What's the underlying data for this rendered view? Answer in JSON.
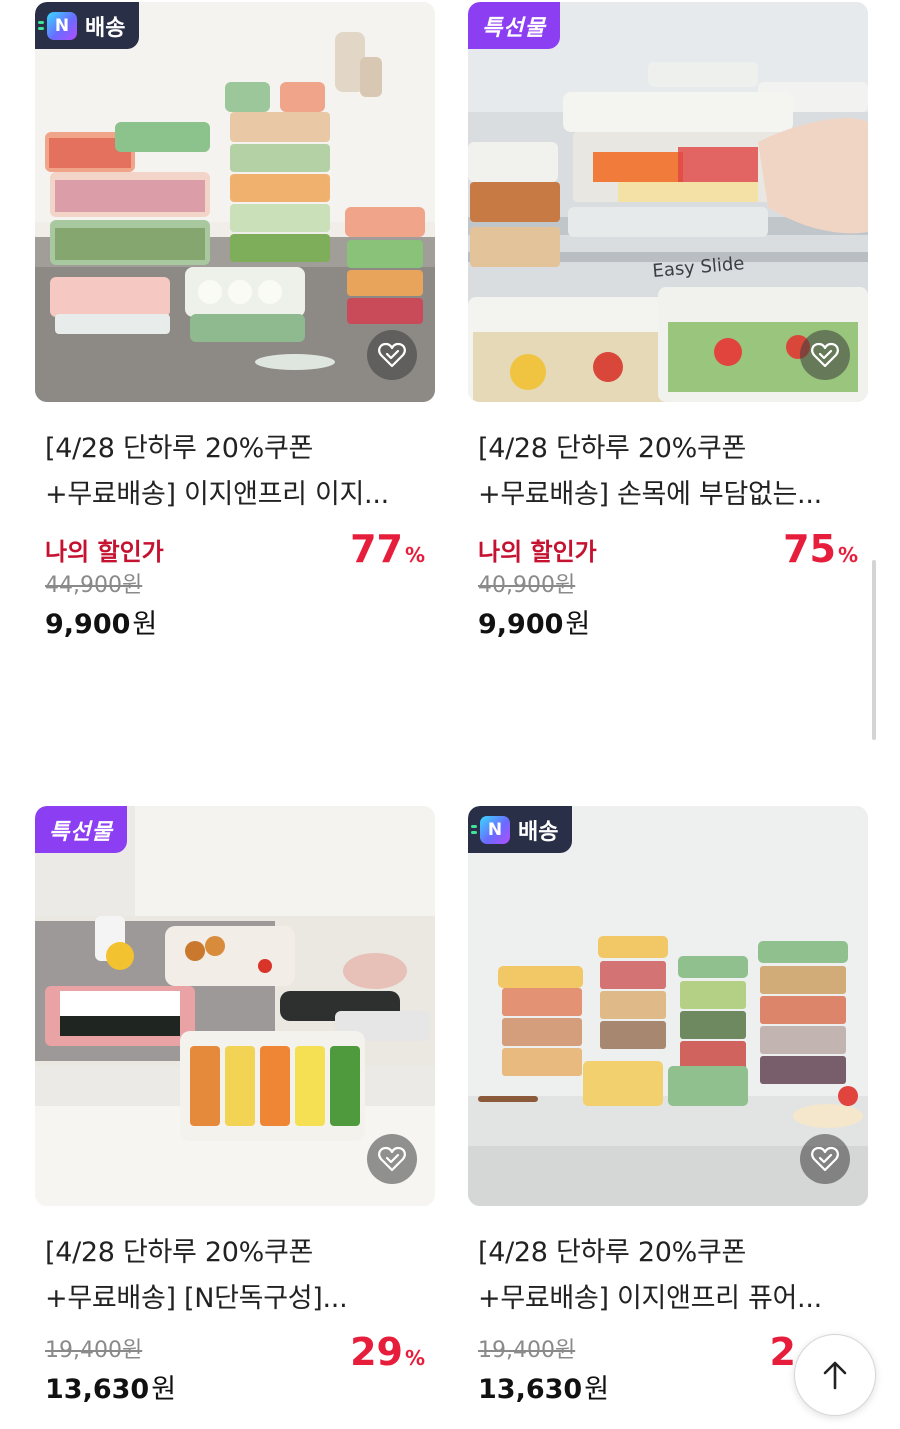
{
  "products": [
    {
      "badge_type": "ndelivery",
      "badge_text": "배송",
      "badge_logo": "N",
      "title_line1": "[4/28 단하루 20%쿠폰",
      "title_line2": "+무료배송] 이지앤프리 이지...",
      "my_price_label": "나의 할인가",
      "original_price": "44,900원",
      "sale_price": "9,900",
      "currency": "원",
      "discount": "77",
      "pct": "%"
    },
    {
      "badge_type": "gift",
      "badge_text": "특선물",
      "title_line1": "[4/28 단하루 20%쿠폰",
      "title_line2": "+무료배송] 손목에 부담없는...",
      "my_price_label": "나의 할인가",
      "original_price": "40,900원",
      "sale_price": "9,900",
      "currency": "원",
      "discount": "75",
      "pct": "%",
      "image_text": "Easy Slide"
    },
    {
      "badge_type": "gift",
      "badge_text": "특선물",
      "title_line1": "[4/28 단하루 20%쿠폰",
      "title_line2": "+무료배송] [N단독구성]...",
      "original_price": "19,400원",
      "sale_price": "13,630",
      "currency": "원",
      "discount": "29",
      "pct": "%"
    },
    {
      "badge_type": "ndelivery",
      "badge_text": "배송",
      "badge_logo": "N",
      "title_line1": "[4/28 단하루 20%쿠폰",
      "title_line2": "+무료배송] 이지앤프리 퓨어...",
      "original_price": "19,400원",
      "sale_price": "13,630",
      "currency": "원",
      "discount": "2",
      "pct": ""
    }
  ],
  "icons": {
    "wishlist": "heart-check-icon",
    "scroll_top": "arrow-up-icon"
  },
  "colors": {
    "discount": "#e61e3c",
    "my_price_label": "#c41230",
    "gift_badge": "#8c3ff2",
    "delivery_badge": "#2a2f48"
  }
}
